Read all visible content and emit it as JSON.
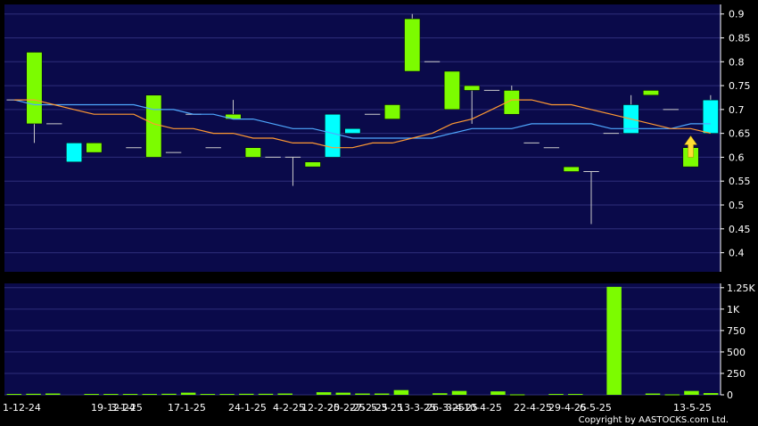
{
  "copyright": "Copyright by AASTOCKS.com Ltd.",
  "colors": {
    "background": "#000000",
    "panel": "#0a0a4a",
    "grid": "#2e2e7a",
    "up_candle": "#00ffff",
    "down_candle": "#7cfc00",
    "ma_short": "#ff9933",
    "ma_long": "#4fa8ff",
    "volume": "#7cfc00",
    "arrow": "#ffdd33",
    "text": "#ffffff"
  },
  "chart_data": [
    {
      "type": "candlestick",
      "title": "",
      "ylim": [
        0.36,
        0.92
      ],
      "y_ticks": [
        0.4,
        0.45,
        0.5,
        0.55,
        0.6,
        0.65,
        0.7,
        0.75,
        0.8,
        0.85,
        0.9
      ],
      "y_tick_labels": [
        "0.4",
        "0.45",
        "0.5",
        "0.55",
        "0.6",
        "0.65",
        "0.7",
        "0.75",
        "0.8",
        "0.85",
        "0.9"
      ],
      "x_tick_labels": [
        "1-12-24",
        "19-12-24",
        "3-1-25",
        "17-1-25",
        "24-1-25",
        "4-2-25",
        "12-2-25",
        "20-2-25",
        "27-2-25",
        "5-3-25",
        "13-3-25",
        "26-3-25",
        "3-4-25",
        "10-4-25",
        "22-4-25",
        "29-4-25",
        "6-5-25",
        "13-5-25"
      ],
      "candles": [
        {
          "o": 0.72,
          "h": 0.72,
          "l": 0.72,
          "c": 0.72
        },
        {
          "o": 0.82,
          "h": 0.82,
          "l": 0.63,
          "c": 0.67
        },
        {
          "o": 0.67,
          "h": 0.67,
          "l": 0.67,
          "c": 0.67
        },
        {
          "o": 0.59,
          "h": 0.63,
          "l": 0.59,
          "c": 0.63
        },
        {
          "o": 0.63,
          "h": 0.63,
          "l": 0.61,
          "c": 0.61
        },
        {
          "o": 0.71,
          "h": 0.71,
          "l": 0.71,
          "c": 0.71
        },
        {
          "o": 0.62,
          "h": 0.62,
          "l": 0.62,
          "c": 0.62
        },
        {
          "o": 0.73,
          "h": 0.73,
          "l": 0.6,
          "c": 0.6
        },
        {
          "o": 0.61,
          "h": 0.61,
          "l": 0.61,
          "c": 0.61
        },
        {
          "o": 0.69,
          "h": 0.69,
          "l": 0.69,
          "c": 0.69
        },
        {
          "o": 0.62,
          "h": 0.62,
          "l": 0.62,
          "c": 0.62
        },
        {
          "o": 0.69,
          "h": 0.72,
          "l": 0.68,
          "c": 0.68
        },
        {
          "o": 0.62,
          "h": 0.62,
          "l": 0.6,
          "c": 0.6
        },
        {
          "o": 0.6,
          "h": 0.6,
          "l": 0.6,
          "c": 0.6
        },
        {
          "o": 0.6,
          "h": 0.6,
          "l": 0.54,
          "c": 0.6
        },
        {
          "o": 0.59,
          "h": 0.59,
          "l": 0.58,
          "c": 0.58
        },
        {
          "o": 0.6,
          "h": 0.69,
          "l": 0.6,
          "c": 0.69
        },
        {
          "o": 0.65,
          "h": 0.66,
          "l": 0.65,
          "c": 0.66
        },
        {
          "o": 0.69,
          "h": 0.69,
          "l": 0.69,
          "c": 0.69
        },
        {
          "o": 0.71,
          "h": 0.71,
          "l": 0.68,
          "c": 0.68
        },
        {
          "o": 0.89,
          "h": 0.9,
          "l": 0.78,
          "c": 0.78
        },
        {
          "o": 0.8,
          "h": 0.8,
          "l": 0.8,
          "c": 0.8
        },
        {
          "o": 0.78,
          "h": 0.78,
          "l": 0.7,
          "c": 0.7
        },
        {
          "o": 0.75,
          "h": 0.75,
          "l": 0.67,
          "c": 0.74
        },
        {
          "o": 0.74,
          "h": 0.74,
          "l": 0.74,
          "c": 0.74
        },
        {
          "o": 0.74,
          "h": 0.75,
          "l": 0.69,
          "c": 0.69
        },
        {
          "o": 0.63,
          "h": 0.63,
          "l": 0.63,
          "c": 0.63
        },
        {
          "o": 0.62,
          "h": 0.62,
          "l": 0.62,
          "c": 0.62
        },
        {
          "o": 0.58,
          "h": 0.58,
          "l": 0.57,
          "c": 0.57
        },
        {
          "o": 0.57,
          "h": 0.57,
          "l": 0.46,
          "c": 0.57
        },
        {
          "o": 0.65,
          "h": 0.65,
          "l": 0.65,
          "c": 0.65
        },
        {
          "o": 0.65,
          "h": 0.73,
          "l": 0.65,
          "c": 0.71
        },
        {
          "o": 0.74,
          "h": 0.74,
          "l": 0.73,
          "c": 0.73
        },
        {
          "o": 0.7,
          "h": 0.7,
          "l": 0.7,
          "c": 0.7
        },
        {
          "o": 0.62,
          "h": 0.62,
          "l": 0.58,
          "c": 0.58
        },
        {
          "o": 0.65,
          "h": 0.73,
          "l": 0.65,
          "c": 0.72
        }
      ],
      "ma_short": [
        0.72,
        0.72,
        0.71,
        0.7,
        0.69,
        0.69,
        0.69,
        0.67,
        0.66,
        0.66,
        0.65,
        0.65,
        0.64,
        0.64,
        0.63,
        0.63,
        0.62,
        0.62,
        0.63,
        0.63,
        0.64,
        0.65,
        0.67,
        0.68,
        0.7,
        0.72,
        0.72,
        0.71,
        0.71,
        0.7,
        0.69,
        0.68,
        0.67,
        0.66,
        0.66,
        0.65
      ],
      "ma_long": [
        0.72,
        0.71,
        0.71,
        0.71,
        0.71,
        0.71,
        0.71,
        0.7,
        0.7,
        0.69,
        0.69,
        0.68,
        0.68,
        0.67,
        0.66,
        0.66,
        0.65,
        0.64,
        0.64,
        0.64,
        0.64,
        0.64,
        0.65,
        0.66,
        0.66,
        0.66,
        0.67,
        0.67,
        0.67,
        0.67,
        0.66,
        0.66,
        0.66,
        0.66,
        0.67,
        0.67
      ],
      "signal_arrow_index": 34
    },
    {
      "type": "bar",
      "title": "",
      "ylim": [
        0,
        1300
      ],
      "y_ticks": [
        0,
        250,
        500,
        750,
        1000,
        1250
      ],
      "y_tick_labels": [
        "0",
        "250",
        "500",
        "750",
        "1K",
        "1.25K"
      ],
      "values": [
        10,
        12,
        15,
        0,
        10,
        10,
        10,
        10,
        12,
        25,
        10,
        10,
        12,
        12,
        15,
        0,
        30,
        25,
        15,
        15,
        55,
        0,
        18,
        45,
        0,
        40,
        5,
        0,
        10,
        10,
        0,
        1260,
        0,
        15,
        5,
        45,
        20
      ]
    }
  ]
}
